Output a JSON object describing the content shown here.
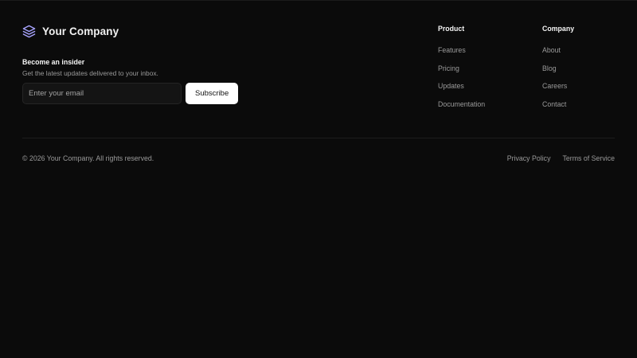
{
  "brand": {
    "name": "Your Company",
    "icon": "layers-icon",
    "icon_color": "#a8a4ff"
  },
  "newsletter": {
    "title": "Become an insider",
    "description": "Get the latest updates delivered to your inbox.",
    "email_placeholder": "Enter your email",
    "subscribe_label": "Subscribe"
  },
  "columns": {
    "product": {
      "title": "Product",
      "links": [
        "Features",
        "Pricing",
        "Updates",
        "Documentation"
      ]
    },
    "company": {
      "title": "Company",
      "links": [
        "About",
        "Blog",
        "Careers",
        "Contact"
      ]
    }
  },
  "footer": {
    "copyright": "© 2026 Your Company. All rights reserved.",
    "legal_links": [
      "Privacy Policy",
      "Terms of Service"
    ]
  },
  "colors": {
    "background": "#0b0b0b",
    "text_primary": "#f5f5f5",
    "text_muted": "#9a9a9a",
    "button_bg": "#ffffff"
  }
}
